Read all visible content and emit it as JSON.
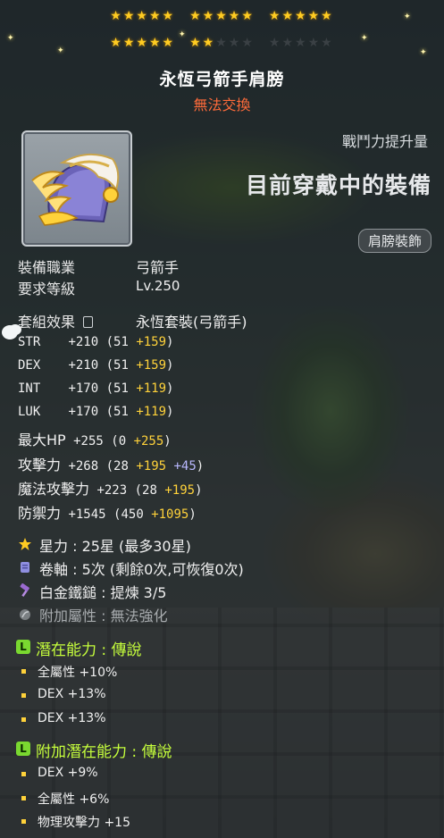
{
  "header": {
    "stars_filled": 22,
    "stars_total": 30,
    "item_name": "永恆弓箭手肩膀",
    "trade_status": "無法交換"
  },
  "item_icon": "golden-winged-shoulder-icon",
  "compare": {
    "power_label": "戰鬥力提升量",
    "equipped_label": "目前穿戴中的裝備",
    "slot_badge": "肩膀裝飾"
  },
  "requirements": {
    "job_label": "裝備職業",
    "job_value": "弓箭手",
    "level_label": "要求等級",
    "level_value": "Lv.250"
  },
  "set": {
    "label": "套組效果",
    "value": "永恆套裝(弓箭手)"
  },
  "stats": [
    {
      "name": "STR",
      "total": "+210",
      "base": "(51",
      "bonus1": "+159",
      "bonus2": "",
      "close": ")"
    },
    {
      "name": "DEX",
      "total": "+210",
      "base": "(51",
      "bonus1": "+159",
      "bonus2": "",
      "close": ")"
    },
    {
      "name": "INT",
      "total": "+170",
      "base": "(51",
      "bonus1": "+119",
      "bonus2": "",
      "close": ")"
    },
    {
      "name": "LUK",
      "total": "+170",
      "base": "(51",
      "bonus1": "+119",
      "bonus2": "",
      "close": ")"
    },
    {
      "name": "最大HP",
      "total": "+255",
      "base": "(0",
      "bonus1": "+255",
      "bonus2": "",
      "close": ")"
    },
    {
      "name": "攻擊力",
      "total": "+268",
      "base": "(28",
      "bonus1": "+195",
      "bonus2": "+45",
      "close": ")"
    },
    {
      "name": "魔法攻擊力",
      "total": "+223",
      "base": "(28",
      "bonus1": "+195",
      "bonus2": "",
      "close": ")"
    },
    {
      "name": "防禦力",
      "total": "+1545",
      "base": "(450",
      "bonus1": "+1095",
      "bonus2": "",
      "close": ")"
    }
  ],
  "enhance": {
    "starforce": "星力 : 25星 (最多30星)",
    "scroll": "卷軸 : 5次 (剩餘0次,可恢復0次)",
    "hammer": "白金鐵鎚 : 提煉 3/5",
    "addl": "附加屬性 : 無法強化"
  },
  "potential": {
    "head": "潛在能力 : 傳說",
    "lines": [
      "全屬性 +10%",
      "DEX +13%",
      "DEX +13%"
    ]
  },
  "additional": {
    "head": "附加潛在能力 : 傳說",
    "lines": [
      "DEX +9%",
      "全屬性 +6%",
      "物理攻擊力 +15"
    ]
  },
  "colors": {
    "gold": "#ffd23a",
    "potential": "#c6ff3c",
    "trade": "#ff6b3a",
    "blue_bonus": "#b9b8ff"
  }
}
